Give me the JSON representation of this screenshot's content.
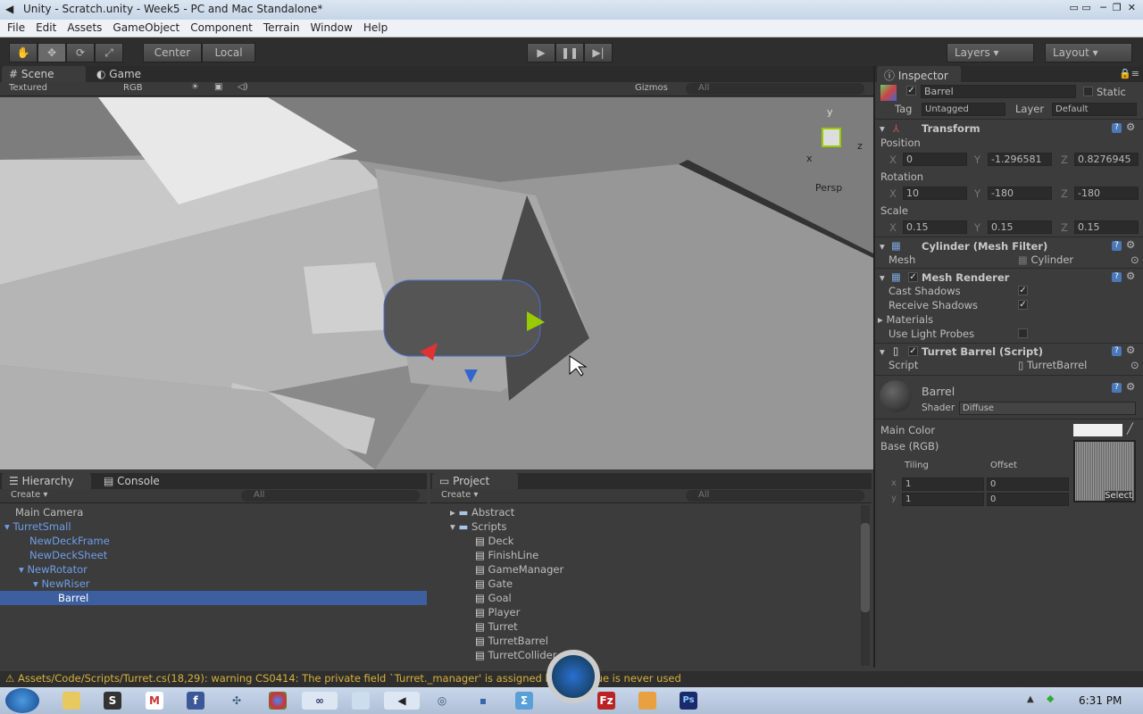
{
  "window": {
    "title": "Unity - Scratch.unity - Week5 - PC and Mac Standalone*"
  },
  "menu": [
    "File",
    "Edit",
    "Assets",
    "GameObject",
    "Component",
    "Terrain",
    "Window",
    "Help"
  ],
  "toolbar": {
    "center": "Center",
    "local": "Local",
    "layers": "Layers",
    "layout": "Layout"
  },
  "scene": {
    "tab": "Scene",
    "game_tab": "Game",
    "render_mode": "Textured",
    "color_mode": "RGB",
    "gizmos": "Gizmos",
    "search": "All",
    "persp": "Persp",
    "axis_x": "x",
    "axis_y": "y",
    "axis_z": "z"
  },
  "hierarchy": {
    "tab": "Hierarchy",
    "console_tab": "Console",
    "create": "Create",
    "search": "All",
    "items": [
      {
        "label": "Main Camera",
        "level": 0
      },
      {
        "label": "TurretSmall",
        "level": 0
      },
      {
        "label": "NewDeckFrame",
        "level": 1
      },
      {
        "label": "NewDeckSheet",
        "level": 1
      },
      {
        "label": "NewRotator",
        "level": 1
      },
      {
        "label": "NewRiser",
        "level": 2
      },
      {
        "label": "Barrel",
        "level": 3
      }
    ]
  },
  "project": {
    "tab": "Project",
    "create": "Create",
    "search": "All",
    "folders": [
      "Abstract",
      "Scripts"
    ],
    "scripts": [
      "Deck",
      "FinishLine",
      "GameManager",
      "Gate",
      "Goal",
      "Player",
      "Turret",
      "TurretBarrel",
      "TurretCollider"
    ]
  },
  "inspector": {
    "tab": "Inspector",
    "name": "Barrel",
    "static": "Static",
    "tag_label": "Tag",
    "tag": "Untagged",
    "layer_label": "Layer",
    "layer": "Default",
    "transform": {
      "title": "Transform",
      "position_label": "Position",
      "rotation_label": "Rotation",
      "scale_label": "Scale",
      "position": {
        "x": "0",
        "y": "-1.296581",
        "z": "0.8276945"
      },
      "rotation": {
        "x": "10",
        "y": "-180",
        "z": "-180"
      },
      "scale": {
        "x": "0.15",
        "y": "0.15",
        "z": "0.15"
      }
    },
    "mesh_filter": {
      "title": "Cylinder (Mesh Filter)",
      "mesh_label": "Mesh",
      "mesh": "Cylinder"
    },
    "mesh_renderer": {
      "title": "Mesh Renderer",
      "cast": "Cast Shadows",
      "receive": "Receive Shadows",
      "materials": "Materials",
      "probes": "Use Light Probes"
    },
    "script": {
      "title": "Turret Barrel (Script)",
      "label": "Script",
      "value": "TurretBarrel"
    },
    "material": {
      "name": "Barrel",
      "shader_label": "Shader",
      "shader": "Diffuse",
      "main_color": "Main Color",
      "base": "Base (RGB)",
      "tiling": "Tiling",
      "offset": "Offset",
      "x": "x",
      "y": "y",
      "tx": "1",
      "ty": "1",
      "ox": "0",
      "oy": "0",
      "select": "Select"
    }
  },
  "status": {
    "warning": "Assets/Code/Scripts/Turret.cs(18,29): warning CS0414: The private field `Turret._manager' is assigned but its value is never used"
  },
  "clock": "6:31 PM",
  "colors": {
    "selection": "#3d5fa0",
    "prefab_blue": "#6f9ee8",
    "warning": "#d8b13a"
  }
}
